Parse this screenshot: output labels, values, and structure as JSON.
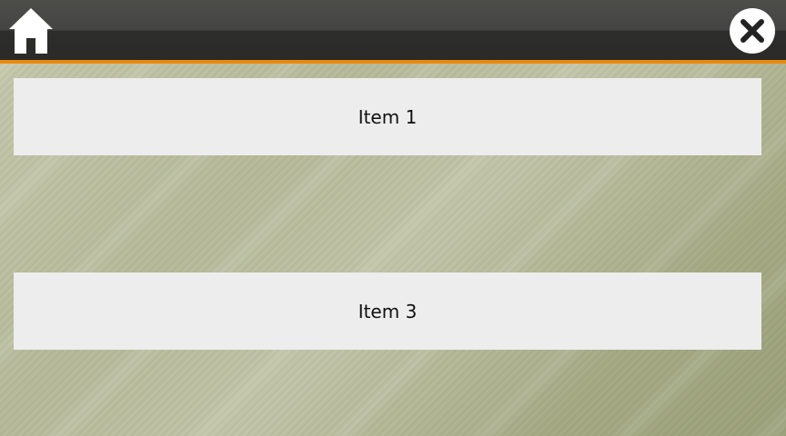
{
  "header": {
    "home_icon": "home-icon",
    "close_icon": "close-icon",
    "accent_color": "#e8890b"
  },
  "list": {
    "items": [
      {
        "label": "Item 1"
      },
      {
        "label": "Item 3"
      }
    ]
  }
}
